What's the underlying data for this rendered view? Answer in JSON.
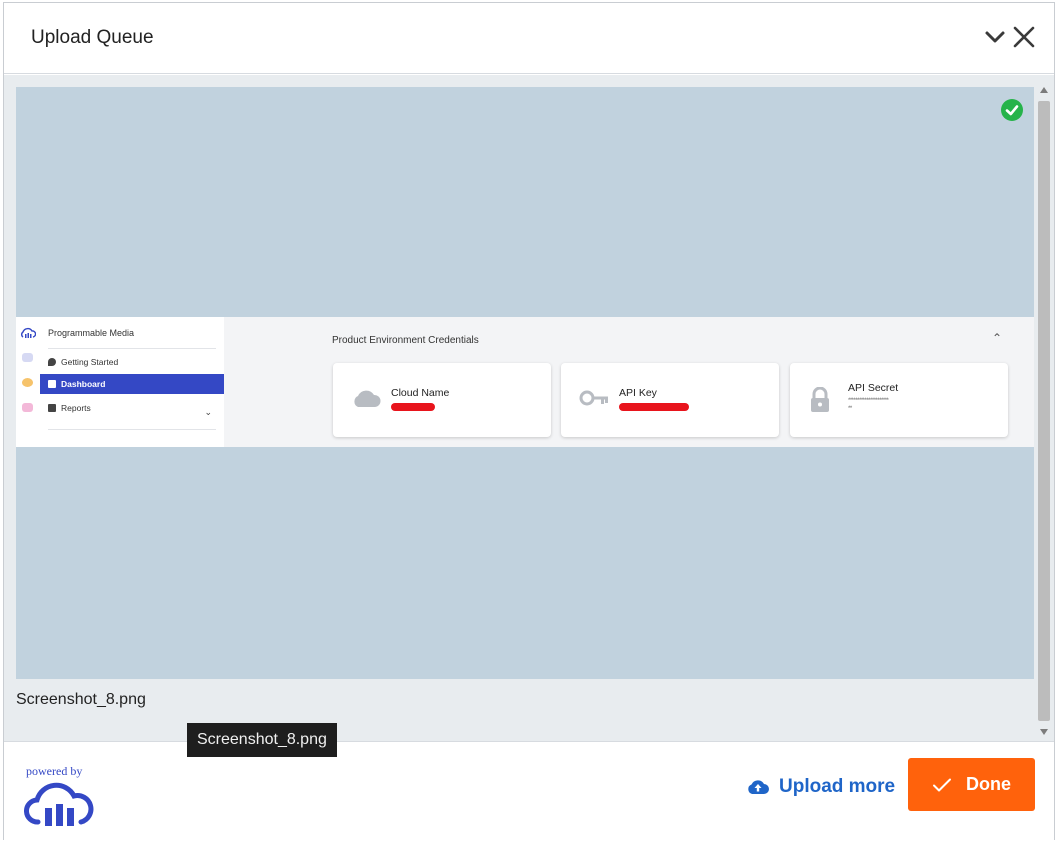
{
  "dialog": {
    "title": "Upload Queue"
  },
  "item": {
    "filename": "Screenshot_8.png",
    "status": "uploaded",
    "tooltip": "Screenshot_8.png"
  },
  "thumbnail": {
    "brand": "Programmable Media",
    "nav": [
      {
        "label": "Getting Started"
      },
      {
        "label": "Dashboard"
      },
      {
        "label": "Reports"
      }
    ],
    "section_title": "Product Environment Credentials",
    "cards": [
      {
        "label": "Cloud Name",
        "icon": "cloud-icon"
      },
      {
        "label": "API Key",
        "icon": "key-icon"
      },
      {
        "label": "API Secret",
        "icon": "lock-icon",
        "value": "**********************"
      }
    ],
    "secret_suffix": "**"
  },
  "footer": {
    "powered_by": "powered by",
    "upload_more_label": "Upload more",
    "done_label": "Done"
  },
  "colors": {
    "accent_orange": "#ff620c",
    "link_blue": "#1f65c8",
    "brand_blue": "#3448c5",
    "success_green": "#26b34a",
    "redaction_red": "#e8141c"
  }
}
